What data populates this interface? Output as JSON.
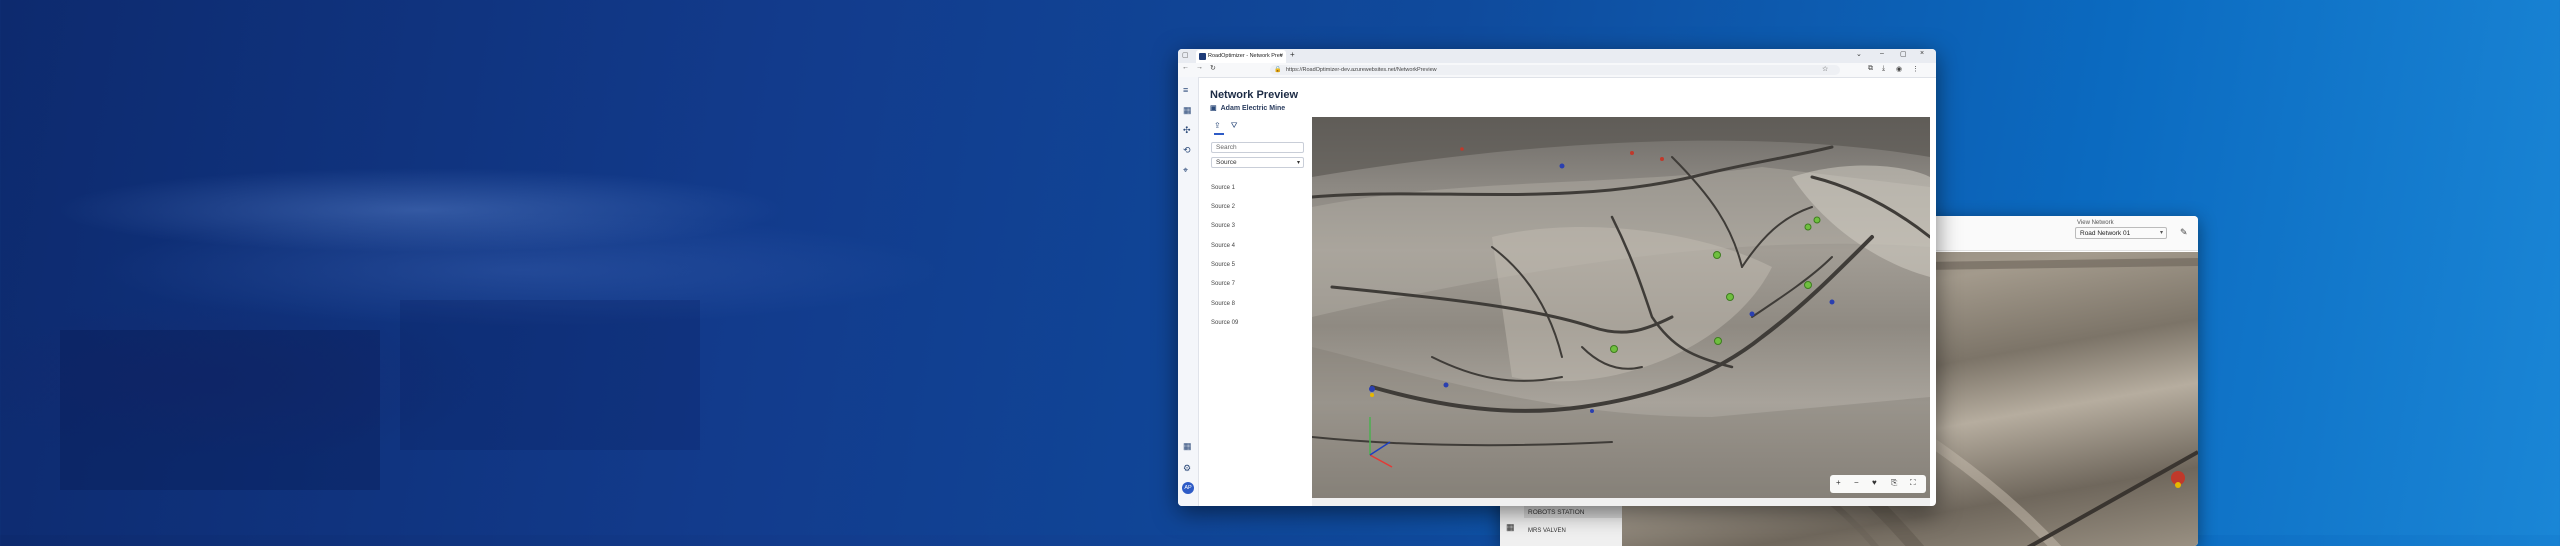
{
  "browser": {
    "tab_title": "RoadOptimizer - Network Prev",
    "url": "https://RoadOptimizer-dev.azurewebsites.net/NetworkPreview"
  },
  "app": {
    "page_title": "Network Preview",
    "site_name": "Adam Electric Mine",
    "search_placeholder": "Search",
    "select_value": "Source",
    "sources": [
      "Source 1",
      "Source 2",
      "Source 3",
      "Source 4",
      "Source 5",
      "Source 7",
      "Source 8",
      "Source 09"
    ],
    "avatar_initials": "AP"
  },
  "secondary_window": {
    "view_network_label": "View Network",
    "view_network_value": "Road Network 01",
    "list_items": [
      "ROBOTS STATION",
      "MRS VALVEN"
    ]
  },
  "map_controls": [
    "zoom-in",
    "zoom-out",
    "compass",
    "layers",
    "fullscreen"
  ],
  "colors": {
    "accent": "#2e5bc6",
    "marker_green": "#6fbf3f",
    "marker_blue": "#2a3fb0",
    "marker_red": "#c0392b"
  }
}
